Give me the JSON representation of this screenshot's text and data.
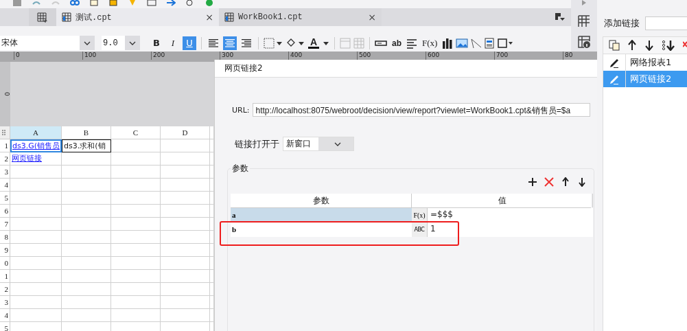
{
  "tabs": [
    {
      "label": "测试.cpt",
      "selected": true,
      "close": "×"
    },
    {
      "label": "WorkBook1.cpt",
      "selected": false,
      "close": "×"
    }
  ],
  "format_bar": {
    "font": "宋体",
    "size": "9.0",
    "style_buttons": [
      {
        "label": "B",
        "kind": "bold",
        "selected": false
      },
      {
        "label": "I",
        "kind": "italic",
        "selected": false
      },
      {
        "label": "U",
        "kind": "underline",
        "selected": true
      }
    ],
    "align_buttons": [
      {
        "kind": "left",
        "selected": false
      },
      {
        "kind": "center",
        "selected": true
      },
      {
        "kind": "right",
        "selected": false
      }
    ],
    "font_color_label": "A",
    "text_label": "ab",
    "formula_label": "F(x)"
  },
  "ruler": {
    "labels": [
      "0",
      "100",
      "200",
      "300",
      "400",
      "500",
      "600",
      "700",
      "80"
    ],
    "side_label": "0"
  },
  "sheet": {
    "columns": [
      {
        "label": "A",
        "selected": true
      },
      {
        "label": "B",
        "selected": false
      },
      {
        "label": "C",
        "selected": false
      },
      {
        "label": "D",
        "selected": false
      }
    ],
    "rows": [
      {
        "label": "1",
        "cells": [
          {
            "text": "ds3.G(销售员",
            "kind": "link",
            "selected": true
          },
          {
            "text": "ds3.求和(销",
            "kind": "plain",
            "selected": false
          }
        ]
      },
      {
        "label": "2",
        "cells": [
          {
            "text": "网页链接",
            "kind": "link",
            "selected": false
          }
        ]
      },
      {
        "label": "3",
        "cells": []
      },
      {
        "label": "4",
        "cells": []
      },
      {
        "label": "5",
        "cells": []
      },
      {
        "label": "6",
        "cells": []
      },
      {
        "label": "7",
        "cells": []
      },
      {
        "label": "8",
        "cells": []
      },
      {
        "label": "9",
        "cells": []
      },
      {
        "label": "0",
        "cells": []
      },
      {
        "label": "1",
        "cells": []
      },
      {
        "label": "2",
        "cells": []
      },
      {
        "label": "3",
        "cells": []
      },
      {
        "label": "4",
        "cells": []
      },
      {
        "label": "5",
        "cells": []
      }
    ]
  },
  "dialog": {
    "title": "网页链接2",
    "url_label": "URL:",
    "url": "http://localhost:8075/webroot/decision/view/report?viewlet=WorkBook1.cpt&销售员=$a",
    "open_label": "链接打开于",
    "open_value": "新窗口",
    "params": {
      "legend": "参数",
      "columns": [
        "参数",
        "值"
      ],
      "rows": [
        {
          "name": "a",
          "type_label": "F(x)",
          "value": "=$$$",
          "selected": true
        },
        {
          "name": "b",
          "type_label": "ABC",
          "value": "1",
          "selected": false
        }
      ]
    }
  },
  "hyperlink_panel": {
    "add_label": "添加链接",
    "items": [
      {
        "label": "网络报表1",
        "selected": false
      },
      {
        "label": "网页链接2",
        "selected": true
      }
    ]
  }
}
